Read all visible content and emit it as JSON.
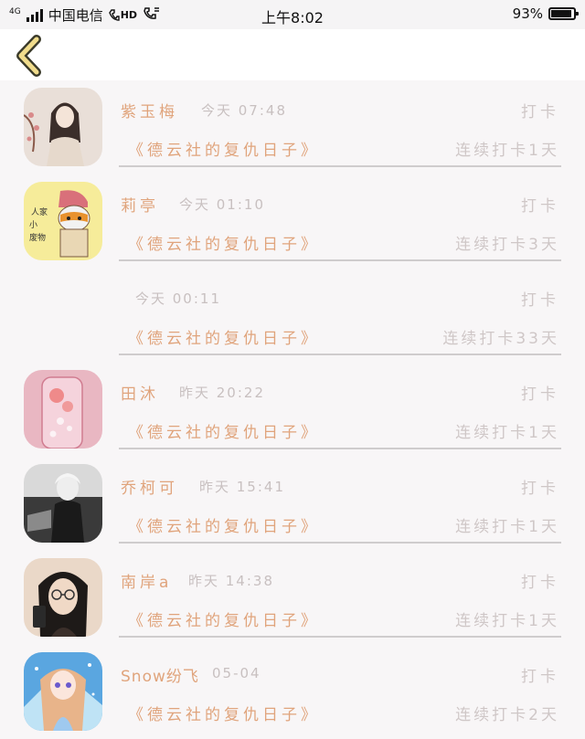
{
  "status_bar": {
    "network": "4G",
    "carrier": "中国电信",
    "hd": "HD",
    "time": "上午8:02",
    "battery": "93%",
    "battery_level": 0.93
  },
  "header": {
    "back_icon": "chevron-left-icon",
    "accent_color": "#f0dc8c"
  },
  "records": [
    {
      "name": "紫玉梅",
      "time": "今天 07:48",
      "checkin": "打卡",
      "book": "《德云社的复仇日子》",
      "streak": "连续打卡1天",
      "avatar": "portrait-photo"
    },
    {
      "name": "莉亭",
      "time": "今天 01:10",
      "checkin": "打卡",
      "book": "《德云社的复仇日子》",
      "streak": "连续打卡3天",
      "avatar": "cat-cartoon",
      "avatar_text": "人家是可爱的小废物"
    },
    {
      "name": "",
      "time": "今天 00:11",
      "checkin": "打卡",
      "book": "《德云社的复仇日子》",
      "streak": "连续打卡33天",
      "avatar": "none"
    },
    {
      "name": "田沐",
      "time": "昨天 20:22",
      "checkin": "打卡",
      "book": "《德云社的复仇日子》",
      "streak": "连续打卡1天",
      "avatar": "pink-drink-photo"
    },
    {
      "name": "乔柯可",
      "time": "昨天 15:41",
      "checkin": "打卡",
      "book": "《德云社的复仇日子》",
      "streak": "连续打卡1天",
      "avatar": "black-white-photo"
    },
    {
      "name": "南岸a",
      "time": "昨天 14:38",
      "checkin": "打卡",
      "book": "《德云社的复仇日子》",
      "streak": "连续打卡1天",
      "avatar": "girl-glasses-photo"
    },
    {
      "name": "Snow纷飞",
      "time": "05-04",
      "checkin": "打卡",
      "book": "《德云社的复仇日子》",
      "streak": "连续打卡2天",
      "avatar": "anime-girl"
    }
  ],
  "colors": {
    "accent": "#e0a47c",
    "muted": "#cfc7c7",
    "background": "#f8f6f7"
  }
}
